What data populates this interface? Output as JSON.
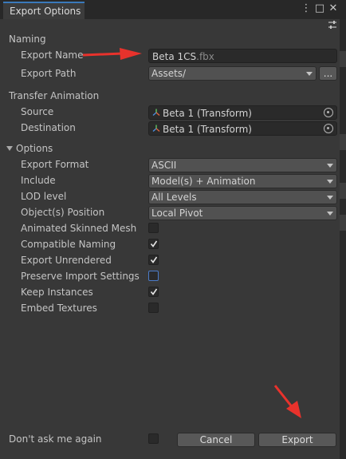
{
  "window": {
    "tab_title": "Export Options",
    "controls": [
      "⋮",
      "□",
      "✕"
    ]
  },
  "naming": {
    "header": "Naming",
    "export_name_label": "Export Name",
    "export_name_value": "Beta 1CS",
    "export_name_ext": ".fbx",
    "export_path_label": "Export Path",
    "export_path_value": "Assets/",
    "browse_label": "..."
  },
  "transfer": {
    "header": "Transfer Animation",
    "source_label": "Source",
    "source_value": "Beta 1 (Transform)",
    "destination_label": "Destination",
    "destination_value": "Beta 1 (Transform)"
  },
  "options": {
    "header": "Options",
    "rows": [
      {
        "label": "Export Format",
        "value": "ASCII"
      },
      {
        "label": "Include",
        "value": "Model(s) + Animation"
      },
      {
        "label": "LOD level",
        "value": "All Levels"
      },
      {
        "label": "Object(s) Position",
        "value": "Local Pivot"
      }
    ],
    "checks": [
      {
        "label": "Animated Skinned Mesh",
        "checked": false
      },
      {
        "label": "Compatible Naming",
        "checked": true
      },
      {
        "label": "Export Unrendered",
        "checked": true
      },
      {
        "label": "Preserve Import Settings",
        "checked": false
      },
      {
        "label": "Keep Instances",
        "checked": true
      },
      {
        "label": "Embed Textures",
        "checked": false
      }
    ]
  },
  "footer": {
    "dont_ask_label": "Don't ask me again",
    "dont_ask_checked": false,
    "cancel_label": "Cancel",
    "export_label": "Export"
  },
  "colors": {
    "annotation_arrow": "#e8322c",
    "tab_accent": "#3a79bb"
  }
}
